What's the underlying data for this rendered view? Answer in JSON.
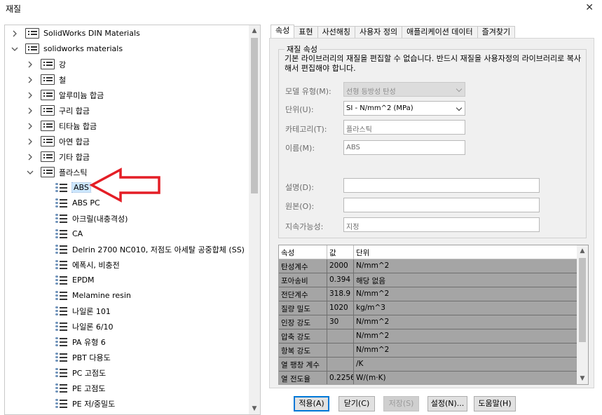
{
  "window": {
    "title": "재질",
    "close_icon": "close-icon"
  },
  "tree": {
    "items": [
      {
        "label": "SolidWorks DIN Materials",
        "kind": "library",
        "expanded": false,
        "level": 0
      },
      {
        "label": "solidworks materials",
        "kind": "library",
        "expanded": true,
        "level": 0
      },
      {
        "label": "강",
        "kind": "category",
        "expanded": false,
        "level": 1
      },
      {
        "label": "철",
        "kind": "category",
        "expanded": false,
        "level": 1
      },
      {
        "label": "알루미늄 합금",
        "kind": "category",
        "expanded": false,
        "level": 1
      },
      {
        "label": "구리 합금",
        "kind": "category",
        "expanded": false,
        "level": 1
      },
      {
        "label": "티타늄 합금",
        "kind": "category",
        "expanded": false,
        "level": 1
      },
      {
        "label": "아연 합금",
        "kind": "category",
        "expanded": false,
        "level": 1
      },
      {
        "label": "기타 합금",
        "kind": "category",
        "expanded": false,
        "level": 1
      },
      {
        "label": "플라스틱",
        "kind": "category",
        "expanded": true,
        "level": 1
      },
      {
        "label": "ABS",
        "kind": "material",
        "selected": true,
        "level": 2
      },
      {
        "label": "ABS PC",
        "kind": "material",
        "level": 2
      },
      {
        "label": "아크릴(내충격성)",
        "kind": "material",
        "level": 2
      },
      {
        "label": "CA",
        "kind": "material",
        "level": 2
      },
      {
        "label": "Delrin 2700 NC010, 저점도 아세탈 공중합체 (SS)",
        "kind": "material",
        "level": 2
      },
      {
        "label": "에폭시, 비충전",
        "kind": "material",
        "level": 2
      },
      {
        "label": "EPDM",
        "kind": "material",
        "level": 2
      },
      {
        "label": "Melamine resin",
        "kind": "material",
        "level": 2
      },
      {
        "label": "나일론 101",
        "kind": "material",
        "level": 2
      },
      {
        "label": "나일론 6/10",
        "kind": "material",
        "level": 2
      },
      {
        "label": "PA 유형 6",
        "kind": "material",
        "level": 2
      },
      {
        "label": "PBT 다용도",
        "kind": "material",
        "level": 2
      },
      {
        "label": "PC 고점도",
        "kind": "material",
        "level": 2
      },
      {
        "label": "PE 고점도",
        "kind": "material",
        "level": 2
      },
      {
        "label": "PE 저/중밀도",
        "kind": "material",
        "level": 2
      }
    ]
  },
  "annotation": {
    "arrow_color": "#e41e26",
    "description": "red-outline-arrow pointing at ABS"
  },
  "tabs": [
    "속성",
    "표현",
    "사선해칭",
    "사용자 정의",
    "애플리케이션 데이터",
    "즐겨찾기"
  ],
  "active_tab": "속성",
  "properties": {
    "group_title": "재질 속성",
    "description": "기본 라이브러리의 재질을 편집할 수 없습니다. 반드시 재질을 사용자정의 라이브러리로 복사해서 편집해야 합니다.",
    "model_type": {
      "label": "모델 유형(M):",
      "value": "선형 등방성 탄성"
    },
    "units": {
      "label": "단위(U):",
      "value": "SI - N/mm^2 (MPa)"
    },
    "category": {
      "label": "카테고리(T):",
      "value": "플라스틱"
    },
    "name": {
      "label": "이름(M):",
      "value": "ABS"
    },
    "description_field": {
      "label": "설명(D):",
      "value": ""
    },
    "source": {
      "label": "원본(O):",
      "value": ""
    },
    "sustainability": {
      "label": "지속가능성:",
      "value": "지정"
    }
  },
  "table": {
    "headers": [
      "속성",
      "값",
      "단위"
    ],
    "rows": [
      [
        "탄성계수",
        "2000",
        "N/mm^2"
      ],
      [
        "포아송비",
        "0.394",
        "해당 없음"
      ],
      [
        "전단계수",
        "318.9",
        "N/mm^2"
      ],
      [
        "질량 밀도",
        "1020",
        "kg/m^3"
      ],
      [
        "인장 강도",
        "30",
        "N/mm^2"
      ],
      [
        "압축 강도",
        "",
        "N/mm^2"
      ],
      [
        "항복 강도",
        "",
        "N/mm^2"
      ],
      [
        "열 팽창 계수",
        "",
        "/K"
      ],
      [
        "열 전도율",
        "0.2256",
        "W/(m·K)"
      ]
    ]
  },
  "buttons": {
    "apply": "적용(A)",
    "close": "닫기(C)",
    "save": "저장(S)",
    "settings": "설정(N)...",
    "help": "도움말(H)"
  }
}
